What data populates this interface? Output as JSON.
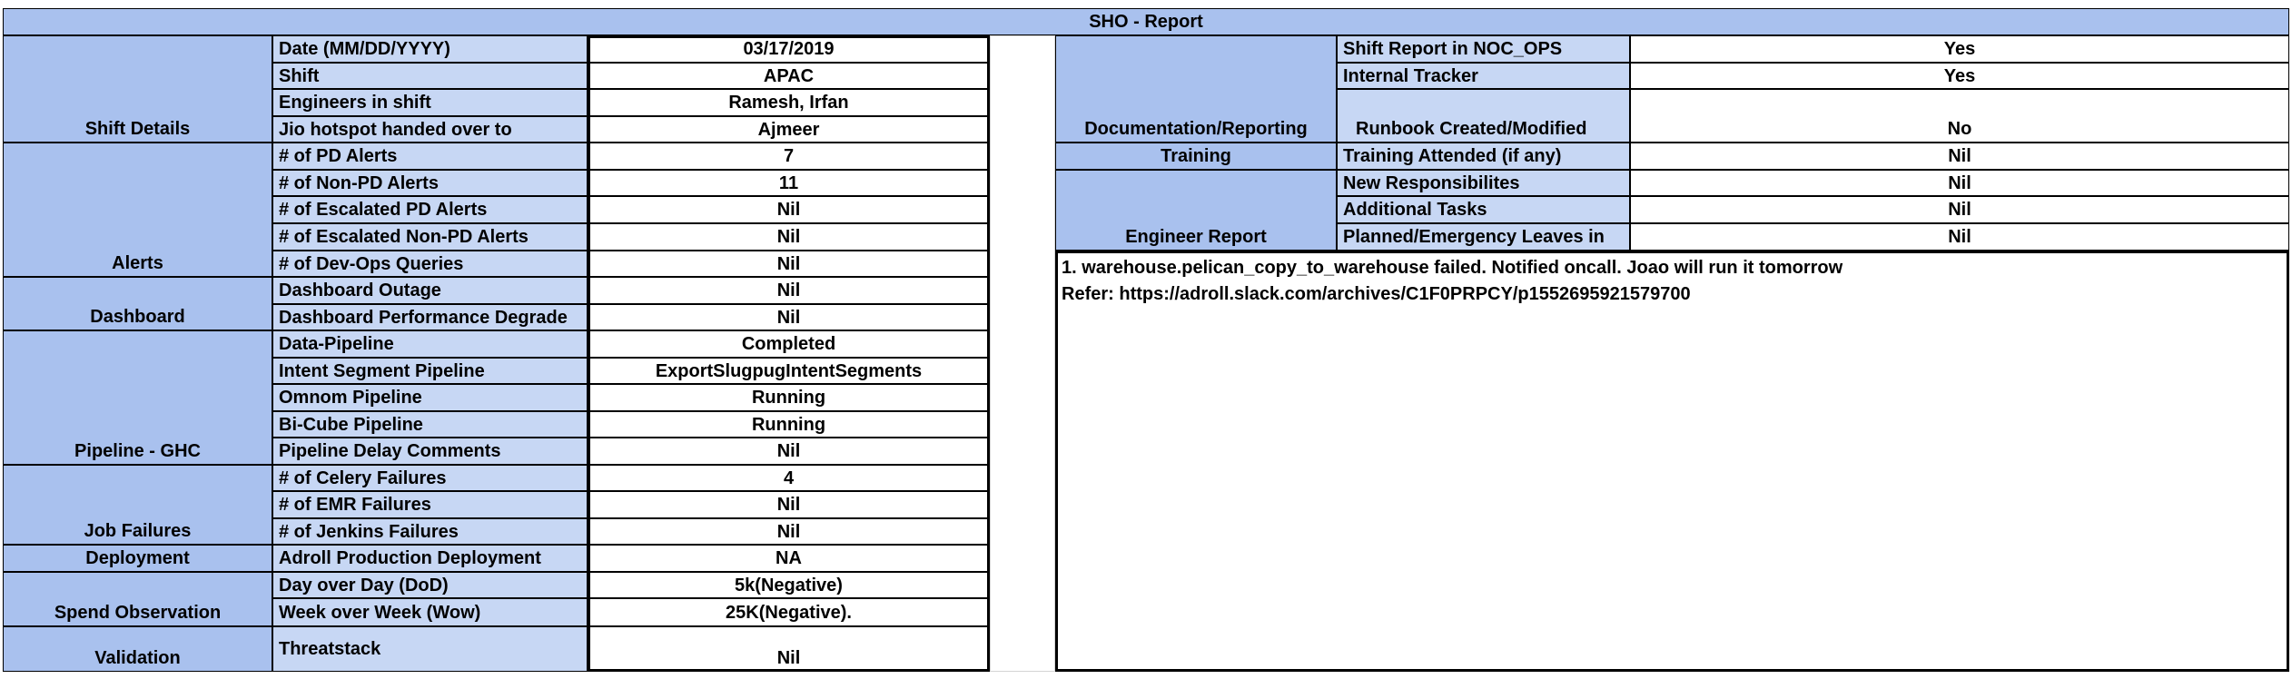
{
  "title": "SHO - Report",
  "colors": {
    "header_blue": "#a9c1ee",
    "label_blue": "#c7d7f4"
  },
  "left": {
    "groups": [
      {
        "name": "Shift Details",
        "rows": [
          {
            "label": "Date (MM/DD/YYYY)",
            "value": "03/17/2019"
          },
          {
            "label": "Shift",
            "value": "APAC"
          },
          {
            "label": "Engineers in shift",
            "value": "Ramesh, Irfan"
          },
          {
            "label": "Jio hotspot handed over to",
            "value": "Ajmeer"
          }
        ]
      },
      {
        "name": "Alerts",
        "rows": [
          {
            "label": "# of PD Alerts",
            "value": "7"
          },
          {
            "label": "# of Non-PD Alerts",
            "value": "11"
          },
          {
            "label": "# of Escalated PD Alerts",
            "value": "Nil"
          },
          {
            "label": "# of Escalated Non-PD Alerts",
            "value": "Nil"
          },
          {
            "label": "# of Dev-Ops Queries",
            "value": "Nil"
          }
        ]
      },
      {
        "name": "Dashboard",
        "rows": [
          {
            "label": "Dashboard Outage",
            "value": "Nil"
          },
          {
            "label": "Dashboard Performance Degrade",
            "value": "Nil"
          }
        ]
      },
      {
        "name": "Pipeline - GHC",
        "rows": [
          {
            "label": "Data-Pipeline",
            "value": "Completed"
          },
          {
            "label": "Intent Segment Pipeline",
            "value": "ExportSlugpugIntentSegments"
          },
          {
            "label": "Omnom Pipeline",
            "value": "Running"
          },
          {
            "label": "Bi-Cube Pipeline",
            "value": "Running"
          },
          {
            "label": "Pipeline Delay Comments",
            "value": "Nil"
          }
        ]
      },
      {
        "name": "Job Failures",
        "rows": [
          {
            "label": "# of Celery Failures",
            "value": "4"
          },
          {
            "label": "# of EMR Failures",
            "value": "Nil"
          },
          {
            "label": "# of Jenkins Failures",
            "value": "Nil"
          }
        ]
      },
      {
        "name": "Deployment",
        "rows": [
          {
            "label": "Adroll Production Deployment",
            "value": "NA"
          }
        ]
      },
      {
        "name": "Spend Observation",
        "rows": [
          {
            "label": "Day over Day (DoD)",
            "value": "5k(Negative)"
          },
          {
            "label": "Week over Week (Wow)",
            "value": "25K(Negative)."
          }
        ]
      },
      {
        "name": "Validation",
        "rows": [
          {
            "label": "Threatstack",
            "value": "Nil"
          }
        ]
      }
    ]
  },
  "right": {
    "groups": [
      {
        "name": "Documentation/Reporting",
        "rows": [
          {
            "label": "Shift Report in NOC_OPS",
            "value": "Yes"
          },
          {
            "label": "Internal Tracker",
            "value": "Yes"
          },
          {
            "label": "Runbook Created/Modified",
            "value": "No"
          }
        ]
      },
      {
        "name": "Training",
        "rows": [
          {
            "label": "Training Attended (if any)",
            "value": "Nil"
          }
        ]
      },
      {
        "name": "Engineer Report",
        "rows": [
          {
            "label": "New Responsibilites",
            "value": "Nil"
          },
          {
            "label": "Additional Tasks",
            "value": "Nil"
          },
          {
            "label": "Planned/Emergency Leaves in",
            "value": "Nil"
          }
        ]
      }
    ],
    "notes": [
      "1. warehouse.pelican_copy_to_warehouse failed. Notified oncall. Joao will run it tomorrow",
      "Refer: https://adroll.slack.com/archives/C1F0PRPCY/p1552695921579700"
    ]
  }
}
